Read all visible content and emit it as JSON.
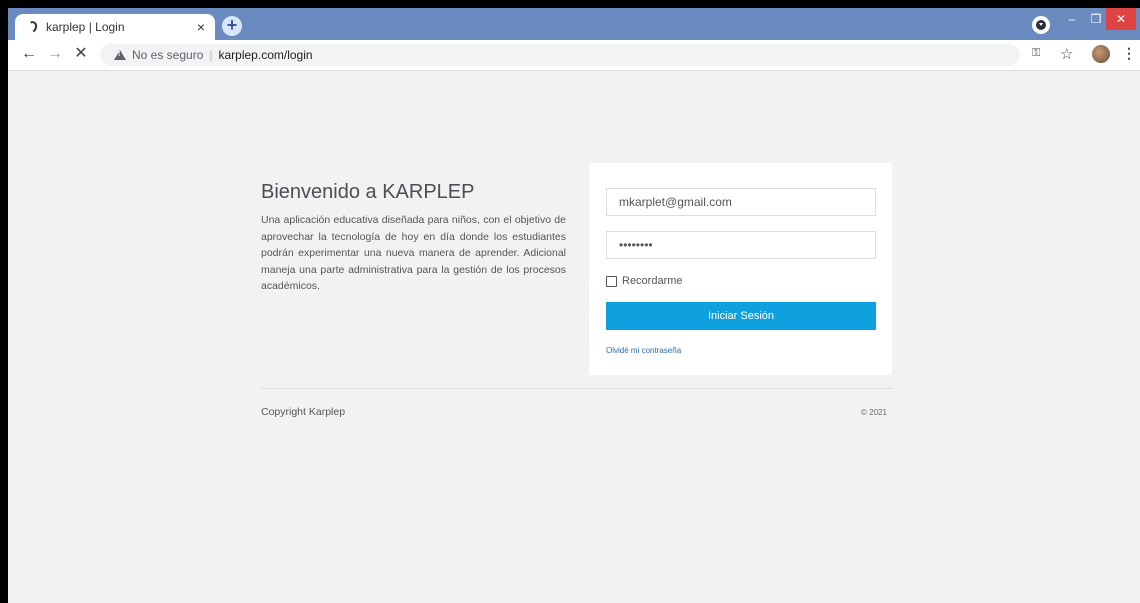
{
  "browser": {
    "tab_title": "karplep | Login",
    "tab_close": "×",
    "new_tab": "+",
    "security_label": "No es seguro",
    "separator": "|",
    "url": "karplep.com/login",
    "nav": {
      "back": "←",
      "forward": "→",
      "stop": "✕"
    },
    "window_controls": {
      "minimize": "–",
      "restore": "❐",
      "close": "✕"
    },
    "icons": {
      "star": "☆",
      "key": "⚿",
      "menu": "⋮"
    }
  },
  "welcome": {
    "title": "Bienvenido a KARPLEP",
    "description": "Una aplicación educativa diseñada para niños, con el objetivo de aprovechar la tecnología de hoy en día donde los estudiantes podrán experimentar una nueva manera de aprender. Adicional maneja una parte administrativa para la gestión de los procesos académicos."
  },
  "login": {
    "email_value": "mkarplet@gmail.com",
    "password_value": "••••••••",
    "remember_label": "Recordarme",
    "remember_checked": false,
    "submit_label": "Iniciar Sesión",
    "forgot_label": "Olvidé mi contraseña"
  },
  "footer": {
    "copyright": "Copyright Karplep",
    "year": "© 2021"
  },
  "colors": {
    "titlebar": "#6a8bc0",
    "primary_button": "#0fa0df",
    "link": "#2a6fb0",
    "page_bg": "#f2f2f2"
  }
}
